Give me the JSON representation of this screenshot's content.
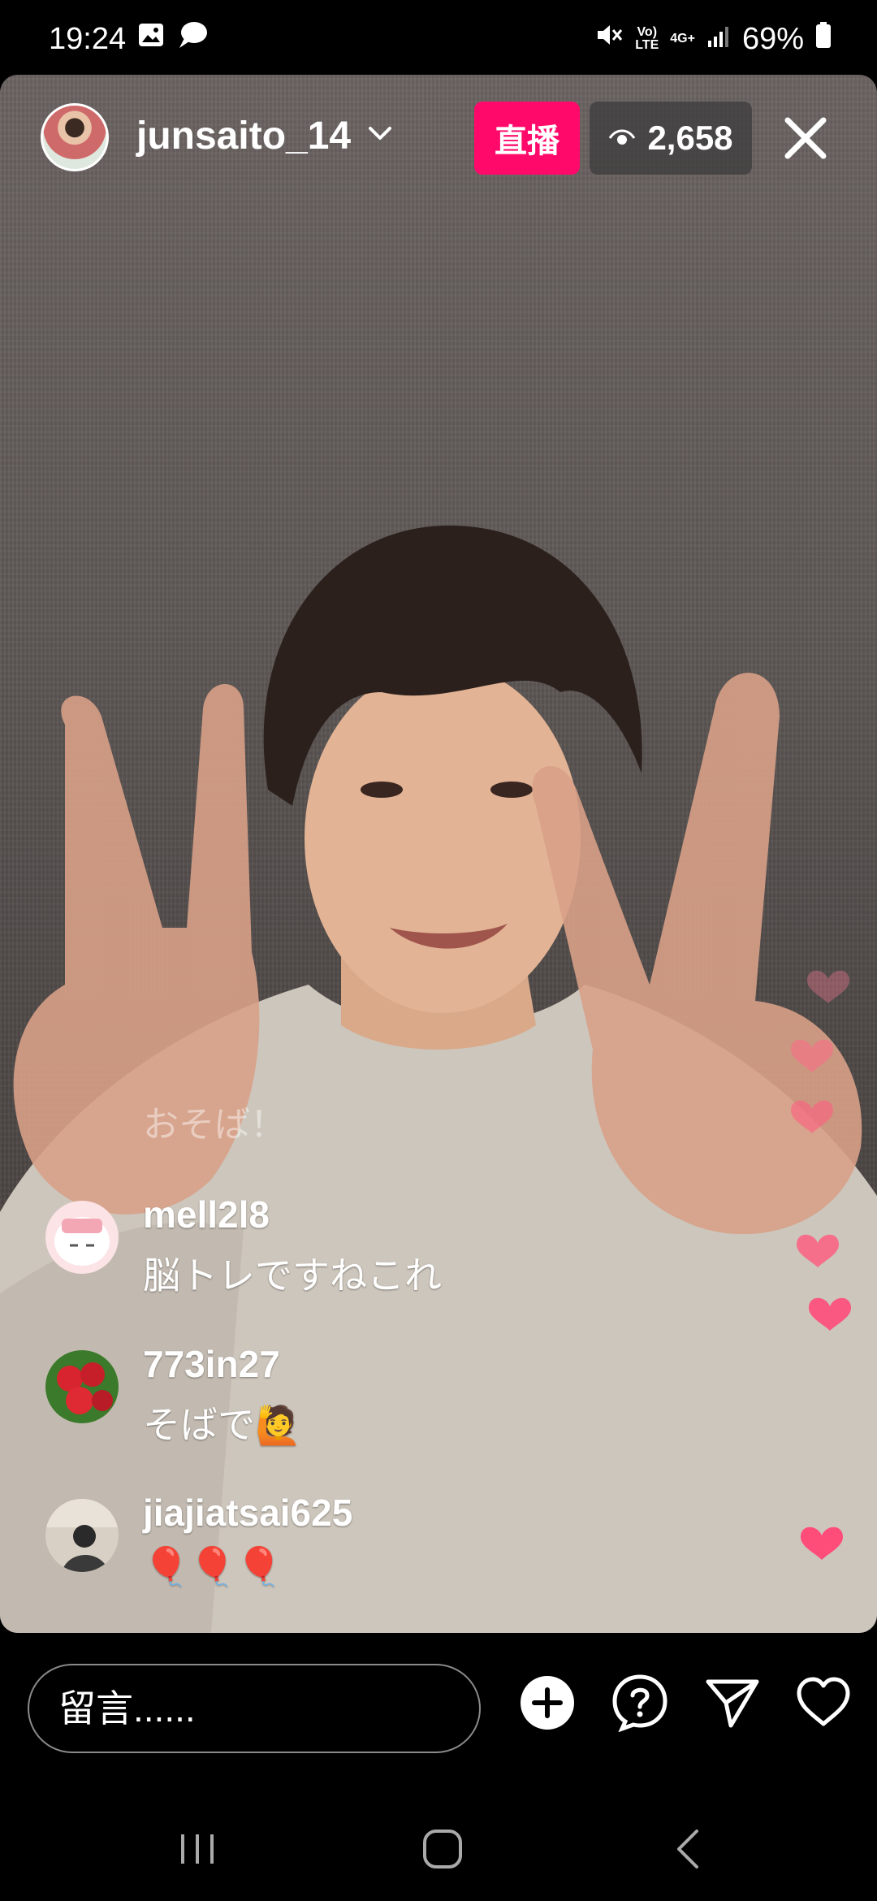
{
  "status_bar": {
    "time": "19:24",
    "volte": "Vo)\nLTE",
    "network": "4G+",
    "battery": "69%"
  },
  "header": {
    "host_username": "junsaito_14",
    "live_label": "直播",
    "viewer_count": "2,658"
  },
  "comments": {
    "faded_text": "おそば！",
    "items": [
      {
        "username": "mell2l8",
        "text": "脳トレですねこれ"
      },
      {
        "username": "773in27",
        "text": "そばで🙋"
      },
      {
        "username": "jiajiatsai625",
        "text": "🎈🎈🎈"
      }
    ]
  },
  "input": {
    "placeholder": "留言......"
  },
  "colors": {
    "live_badge": "#ff0a6b",
    "heart": "#ff4d7a"
  },
  "icons": [
    "image-icon",
    "chat-bubble-icon",
    "mute-icon",
    "signal-icon",
    "battery-icon",
    "chevron-down-icon",
    "eye-icon",
    "close-icon",
    "add-icon",
    "question-icon",
    "send-icon",
    "heart-icon",
    "recent-apps-icon",
    "home-icon",
    "back-icon"
  ]
}
